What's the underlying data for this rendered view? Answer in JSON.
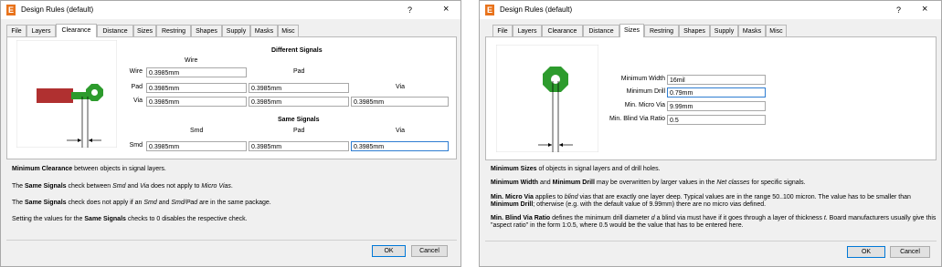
{
  "colors": {
    "pad_green": "#2d9b2d",
    "trace_red": "#b03030",
    "accent": "#0078d7",
    "logo": "#e8731c"
  },
  "left": {
    "title": "Design Rules (default)",
    "logo_letter": "E",
    "help": "?",
    "close": "×",
    "tabs": [
      "File",
      "Layers",
      "Clearance",
      "Distance",
      "Sizes",
      "Restring",
      "Shapes",
      "Supply",
      "Masks",
      "Misc"
    ],
    "active_tab": "Clearance",
    "different_signals": "Different Signals",
    "same_signals": "Same Signals",
    "col_wire": "Wire",
    "col_pad": "Pad",
    "col_via": "Via",
    "col_smd": "Smd",
    "row_wire": "Wire",
    "row_pad": "Pad",
    "row_via": "Via",
    "row_smd": "Smd",
    "values": {
      "wire_wire": "0.3985mm",
      "pad_wire": "0.3985mm",
      "pad_pad": "0.3985mm",
      "via_wire": "0.3985mm",
      "via_pad": "0.3985mm",
      "via_via": "0.3985mm",
      "smd_smd": "0.3985mm",
      "smd_pad": "0.3985mm",
      "smd_via": "0.3985mm"
    },
    "desc": {
      "l1_b": "Minimum Clearance",
      "l1_t": " between objects in signal layers.",
      "l2_a": "The ",
      "l2_b": "Same Signals",
      "l2_c": " check between ",
      "l2_d": "Smd",
      "l2_e": " and ",
      "l2_f": "Via",
      "l2_g": " does not apply to ",
      "l2_h": "Micro Vias",
      "l2_i": ".",
      "l3_a": "The ",
      "l3_b": "Same Signals",
      "l3_c": " check does not apply if an ",
      "l3_d": "Smd",
      "l3_e": " and ",
      "l3_f": "Smd/Pad",
      "l3_g": " are in the same package.",
      "l4_a": "Setting the values for the ",
      "l4_b": "Same Signals",
      "l4_c": " checks to 0 disables the respective check."
    },
    "ok": "OK",
    "cancel": "Cancel"
  },
  "right": {
    "title": "Design Rules (default)",
    "logo_letter": "E",
    "help": "?",
    "close": "×",
    "tabs": [
      "File",
      "Layers",
      "Clearance",
      "Distance",
      "Sizes",
      "Restring",
      "Shapes",
      "Supply",
      "Masks",
      "Misc"
    ],
    "active_tab": "Sizes",
    "fields": [
      {
        "label": "Minimum Width",
        "value": "16mil"
      },
      {
        "label": "Minimum Drill",
        "value": "0.79mm"
      },
      {
        "label": "Min. Micro Via",
        "value": "9.99mm"
      },
      {
        "label": "Min. Blind Via Ratio",
        "value": "0.5"
      }
    ],
    "desc": {
      "l1_b": "Minimum Sizes",
      "l1_t": " of objects in signal layers and of drill holes.",
      "l2_b1": "Minimum Width",
      "l2_a": " and ",
      "l2_b2": "Minimum Drill",
      "l2_c": " may be overwritten by larger values in the ",
      "l2_i": "Net classes",
      "l2_d": " for specific signals.",
      "l3_b": "Min. Micro Via",
      "l3_a": " applies to ",
      "l3_i": "blind",
      "l3_c": " vias that are exactly one layer deep. Typical values are in the range 50..100 micron. The value has to be smaller than",
      "l4_b": "Minimum Drill",
      "l4_a": "; otherwise (e.g. with the default value of 9.99mm) there are no micro vias defined.",
      "l5_b": "Min. Blind Via Ratio",
      "l5_a": " defines the minimum drill diameter ",
      "l5_i1": "d",
      "l5_c": " a blind via must have if it goes through a layer of thickness ",
      "l5_i2": "t",
      "l5_d": ". Board manufacturers usually give this",
      "l6": "\"aspect ratio\" in the form 1:0.5, where 0.5 would be the value that has to be entered here."
    },
    "ok": "OK",
    "cancel": "Cancel"
  }
}
